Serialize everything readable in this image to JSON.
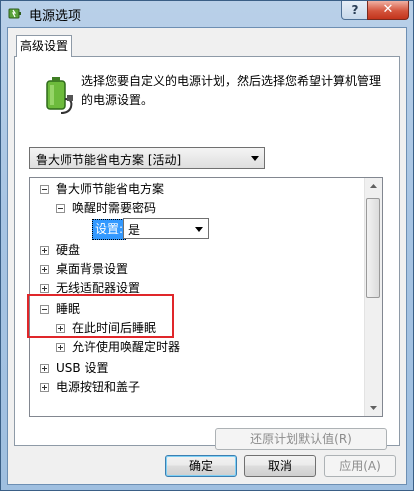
{
  "window": {
    "title": "电源选项",
    "help_label": "?",
    "close_label": "✕"
  },
  "tabs": [
    {
      "label": "高级设置"
    }
  ],
  "description": "选择您要自定义的电源计划，然后选择您希望计算机管理的电源设置。",
  "plan_selector": {
    "selected": "鲁大师节能省电方案 [活动]"
  },
  "tree": {
    "items": [
      {
        "label": "鲁大师节能省电方案",
        "expander": "minus"
      },
      {
        "label": "唤醒时需要密码",
        "expander": "minus"
      },
      {
        "label": "硬盘",
        "expander": "plus"
      },
      {
        "label": "桌面背景设置",
        "expander": "plus"
      },
      {
        "label": "无线适配器设置",
        "expander": "plus"
      },
      {
        "label": "睡眠",
        "expander": "minus"
      },
      {
        "label": "在此时间后睡眠",
        "expander": "plus"
      },
      {
        "label": "允许使用唤醒定时器",
        "expander": "plus"
      },
      {
        "label": "USB 设置",
        "expander": "plus"
      },
      {
        "label": "电源按钮和盖子",
        "expander": "plus"
      }
    ],
    "setting": {
      "label": "设置:",
      "value": "是"
    }
  },
  "buttons": {
    "restore_defaults": "还原计划默认值(R)",
    "ok": "确定",
    "cancel": "取消",
    "apply": "应用(A)"
  },
  "colors": {
    "selection": "#3399ff",
    "highlight_box": "#e0262a"
  }
}
